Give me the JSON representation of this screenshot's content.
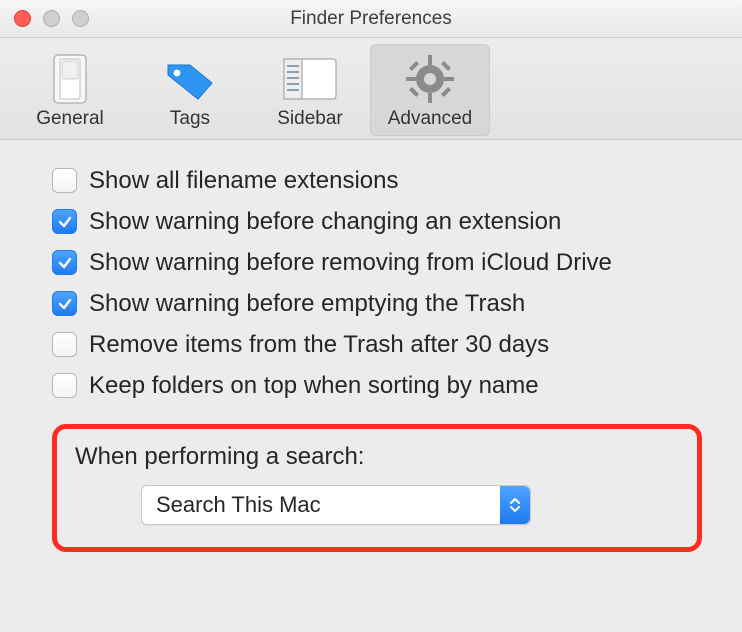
{
  "window": {
    "title": "Finder Preferences"
  },
  "tabs": {
    "general": {
      "label": "General"
    },
    "tags": {
      "label": "Tags"
    },
    "sidebar": {
      "label": "Sidebar"
    },
    "advanced": {
      "label": "Advanced"
    }
  },
  "options": {
    "show_ext": {
      "label": "Show all filename extensions",
      "checked": false
    },
    "warn_ext_change": {
      "label": "Show warning before changing an extension",
      "checked": true
    },
    "warn_icloud_remove": {
      "label": "Show warning before removing from iCloud Drive",
      "checked": true
    },
    "warn_empty_trash": {
      "label": "Show warning before emptying the Trash",
      "checked": true
    },
    "remove_30days": {
      "label": "Remove items from the Trash after 30 days",
      "checked": false
    },
    "folders_on_top": {
      "label": "Keep folders on top when sorting by name",
      "checked": false
    }
  },
  "search": {
    "section_label": "When performing a search:",
    "value": "Search This Mac"
  }
}
